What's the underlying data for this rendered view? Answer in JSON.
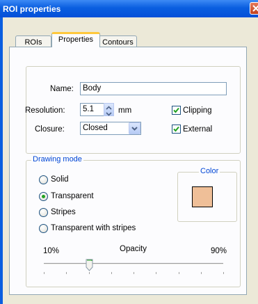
{
  "window": {
    "title": "ROI properties"
  },
  "tabs": [
    {
      "label": "ROIs",
      "active": false
    },
    {
      "label": "Properties",
      "active": true
    },
    {
      "label": "Contours",
      "active": false
    }
  ],
  "properties": {
    "name_label": "Name:",
    "name_value": "Body",
    "resolution_label": "Resolution:",
    "resolution_value": "5.1",
    "resolution_unit": "mm",
    "closure_label": "Closure:",
    "closure_value": "Closed",
    "clipping_label": "Clipping",
    "clipping_checked": true,
    "external_label": "External",
    "external_checked": true
  },
  "drawing_mode": {
    "legend": "Drawing mode",
    "options": [
      {
        "label": "Solid",
        "selected": false
      },
      {
        "label": "Transparent",
        "selected": true
      },
      {
        "label": "Stripes",
        "selected": false
      },
      {
        "label": "Transparent with stripes",
        "selected": false
      }
    ],
    "color_legend": "Color",
    "color": "#efbf98"
  },
  "opacity": {
    "label": "Opacity",
    "min_label": "10%",
    "max_label": "90%",
    "value_percent": 30,
    "tick_count": 9
  },
  "colors": {
    "title_bar": "#0a5ee0",
    "accent_tab": "#ffc83c",
    "legend_text": "#0046d5",
    "check_mark": "#21a121"
  }
}
